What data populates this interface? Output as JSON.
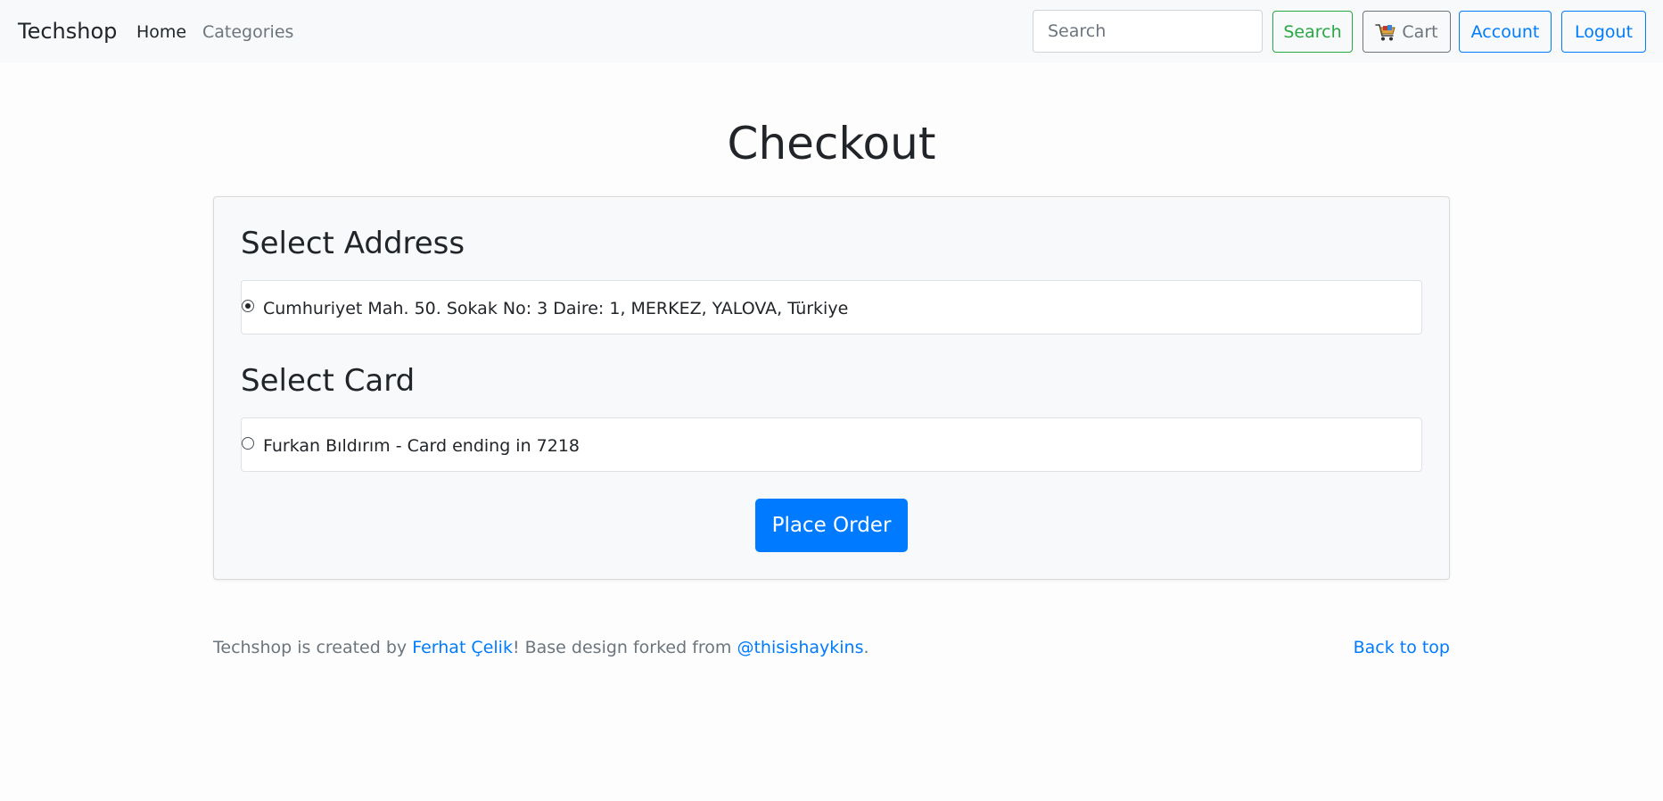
{
  "navbar": {
    "brand": "Techshop",
    "links": [
      {
        "label": "Home"
      },
      {
        "label": "Categories"
      }
    ],
    "search": {
      "placeholder": "Search",
      "value": ""
    },
    "buttons": {
      "search": "Search",
      "cart": "Cart",
      "account": "Account",
      "logout": "Logout"
    },
    "icons": {
      "cart": "shopping-cart-icon"
    }
  },
  "main": {
    "title": "Checkout",
    "address_section": {
      "heading": "Select Address",
      "options": [
        {
          "label": "Cumhuriyet Mah. 50. Sokak No: 3 Daire: 1, MERKEZ, YALOVA, Türkiye",
          "selected": true
        }
      ]
    },
    "card_section": {
      "heading": "Select Card",
      "options": [
        {
          "label": "Furkan Bıldırım - Card ending in 7218",
          "selected": false
        }
      ]
    },
    "place_order_label": "Place Order"
  },
  "footer": {
    "prefix": "Techshop is created by ",
    "author_link": "Ferhat Çelik",
    "middle": "! Base design forked from ",
    "fork_link": "@thisishaykins",
    "suffix": ".",
    "back_to_top": "Back to top"
  },
  "colors": {
    "primary": "#007bff",
    "success": "#28a745",
    "secondary": "#6c757d",
    "navbar_bg": "#f8f9fa"
  }
}
